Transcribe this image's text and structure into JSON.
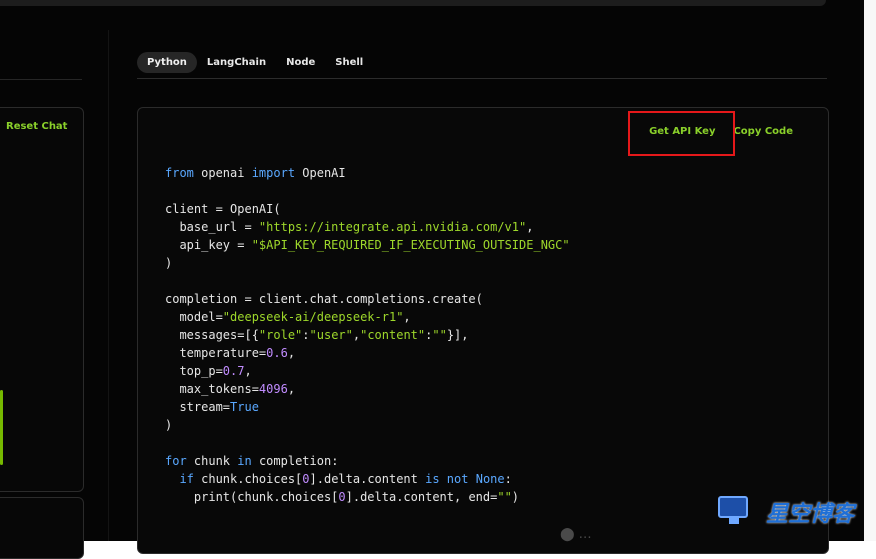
{
  "sidebar": {
    "reset_chat_label": "Reset Chat"
  },
  "tabs": [
    {
      "label": "Python",
      "active": true
    },
    {
      "label": "LangChain",
      "active": false
    },
    {
      "label": "Node",
      "active": false
    },
    {
      "label": "Shell",
      "active": false
    }
  ],
  "code_panel": {
    "get_api_key_label": "Get API Key",
    "copy_code_label": "Copy Code",
    "language": "python",
    "lines": [
      "from openai import OpenAI",
      "",
      "client = OpenAI(",
      "  base_url = \"https://integrate.api.nvidia.com/v1\",",
      "  api_key = \"$API_KEY_REQUIRED_IF_EXECUTING_OUTSIDE_NGC\"",
      ")",
      "",
      "completion = client.chat.completions.create(",
      "  model=\"deepseek-ai/deepseek-r1\",",
      "  messages=[{\"role\":\"user\",\"content\":\"\"}],",
      "  temperature=0.6,",
      "  top_p=0.7,",
      "  max_tokens=4096,",
      "  stream=True",
      ")",
      "",
      "for chunk in completion:",
      "  if chunk.choices[0].delta.content is not None:",
      "    print(chunk.choices[0].delta.content, end=\"\")"
    ]
  },
  "watermark": {
    "logo_text": "星空博客"
  },
  "colors": {
    "accent_green": "#8ad02a",
    "highlight_red": "#e5181a",
    "keyword_blue": "#5aa8ff",
    "number_purple": "#c18cff"
  }
}
